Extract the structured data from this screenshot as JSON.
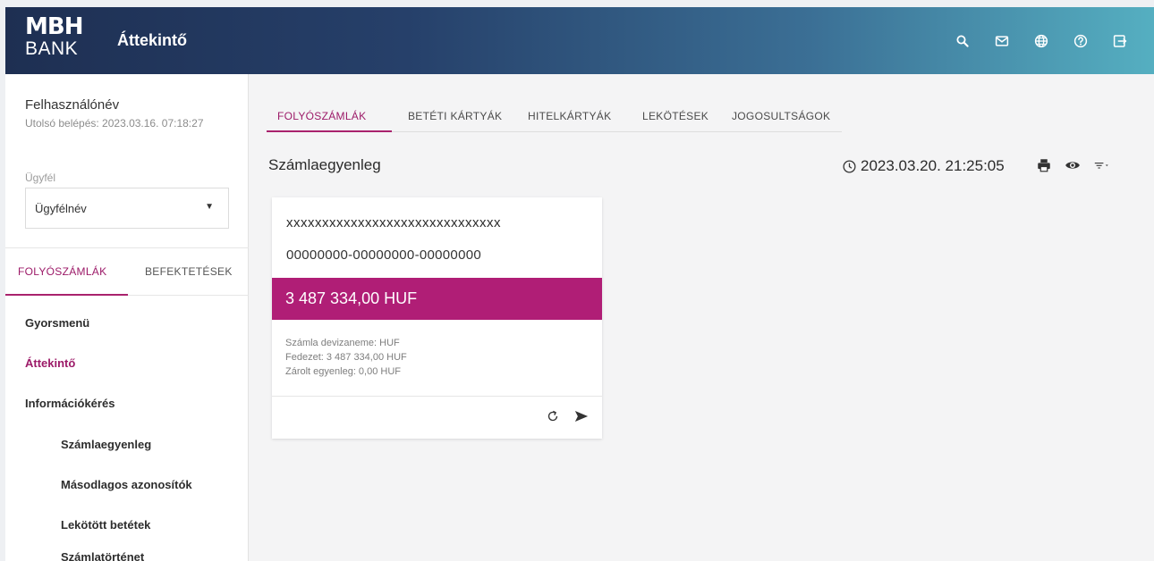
{
  "header": {
    "logo_line1": "MBH",
    "logo_line2": "BANK",
    "title": "Áttekintő",
    "icons": [
      "search-icon",
      "mail-icon",
      "globe-icon",
      "help-icon",
      "logout-icon"
    ]
  },
  "sidebar": {
    "user_name": "Felhasználónév",
    "last_login": "Utolsó belépés: 2023.03.16. 07:18:27",
    "client_label": "Ügyfél",
    "client_value": "Ügyfélnév",
    "tabs": [
      "FOLYÓSZÁMLÁK",
      "BEFEKTETÉSEK"
    ],
    "menu": [
      "Gyorsmenü",
      "Áttekintő",
      "Információkérés",
      "Számlaegyenleg",
      "Másodlagos azonosítók",
      "Lekötött betétek",
      "Számlatörténet"
    ]
  },
  "main": {
    "tabs": [
      "FOLYÓSZÁMLÁK",
      "BETÉTI KÁRTYÁK",
      "HITELKÁRTYÁK",
      "LEKÖTÉSEK",
      "JOGOSULTSÁGOK"
    ],
    "section_title": "Számlaegyenleg",
    "timestamp": "2023.03.20. 21:25:05",
    "tool_icons": [
      "print-icon",
      "eye-icon",
      "filter-icon"
    ]
  },
  "account_card": {
    "name": "xxxxxxxxxxxxxxxxxxxxxxxxxxxxxx",
    "number": "00000000-00000000-00000000",
    "balance": "3 487 334,00 HUF",
    "currency_line": "Számla devizaneme: HUF",
    "coverage_line": "Fedezet: 3 487 334,00 HUF",
    "blocked_line": "Zárolt egyenleg: 0,00 HUF",
    "action_icons": [
      "refresh-icon",
      "send-icon"
    ]
  },
  "colors": {
    "accent": "#b01e76",
    "header_start": "#1e2f52",
    "header_end": "#55afc1"
  }
}
